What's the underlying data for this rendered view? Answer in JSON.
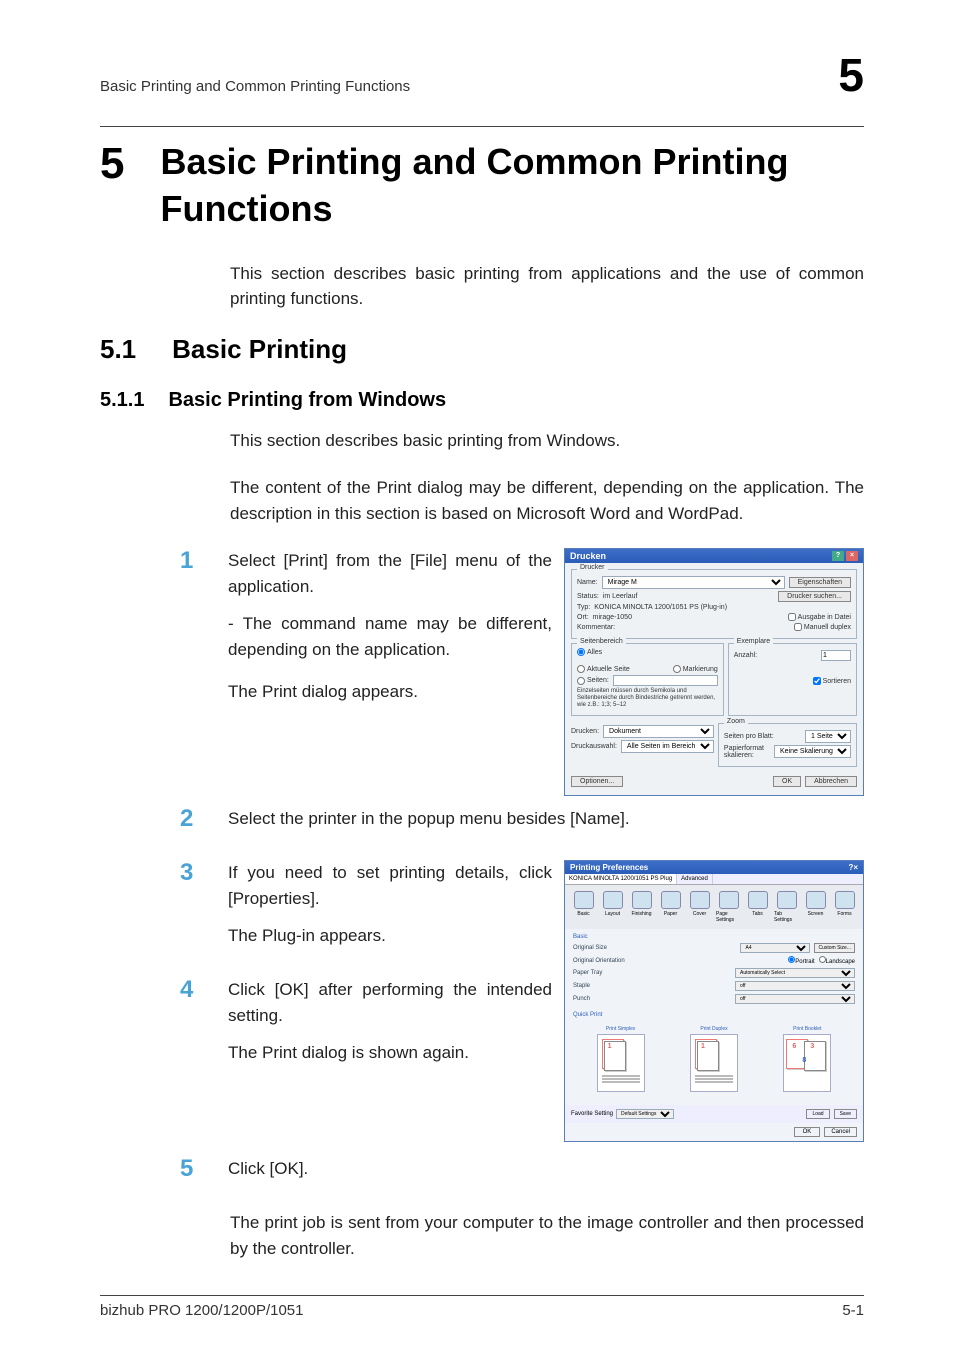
{
  "header": {
    "left": "Basic Printing and Common Printing Functions",
    "right": "5"
  },
  "chapter": {
    "num": "5",
    "title": "Basic Printing and Common Printing Functions"
  },
  "intro": "This section describes basic printing from applications and the use of common printing functions.",
  "sec1": {
    "num": "5.1",
    "title": "Basic Printing"
  },
  "sec2": {
    "num": "5.1.1",
    "title": "Basic Printing from Windows"
  },
  "sec2_p1": "This section describes basic printing from Windows.",
  "sec2_p2": "The content of the Print dialog may be different, depending on the application. The description in this section is based on Microsoft Word and WordPad.",
  "steps": {
    "s1": {
      "num": "1",
      "a": "Select [Print] from the [File] menu of the application.",
      "b": "- The command name may be different, depending on the application.",
      "c": "The Print dialog appears."
    },
    "s2": {
      "num": "2",
      "a": "Select the printer in the popup menu besides [Name]."
    },
    "s3": {
      "num": "3",
      "a": "If you need to set printing details, click [Properties].",
      "b": "The Plug-in appears."
    },
    "s4": {
      "num": "4",
      "a": "Click [OK] after performing the intended setting.",
      "b": "The Print dialog is shown again."
    },
    "s5": {
      "num": "5",
      "a": "Click [OK]."
    }
  },
  "outro": "The print job is sent from your computer to the image controller and then processed by the controller.",
  "footer": {
    "left": "bizhub PRO 1200/1200P/1051",
    "right": "5-1"
  },
  "printdlg": {
    "title": "Drucken",
    "printer_legend": "Drucker",
    "name_lbl": "Name:",
    "name_val": "Mirage M",
    "status_lbl": "Status:",
    "status_val": "im Leerlauf",
    "type_lbl": "Typ:",
    "type_val": "KONICA MINOLTA 1200/1051 PS (Plug-in)",
    "where_lbl": "Ort:",
    "where_val": "mirage-1050",
    "comment_lbl": "Kommentar:",
    "props_btn": "Eigenschaften",
    "find_btn": "Drucker suchen...",
    "tofile": "Ausgabe in Datei",
    "manual": "Manuell duplex",
    "range_legend": "Seitenbereich",
    "all": "Alles",
    "current": "Aktuelle Seite",
    "selection": "Markierung",
    "pages": "Seiten:",
    "range_hint": "Einzelseiten müssen durch Semikola und Seitenbereiche durch Bindestriche getrennt werden, wie z.B.: 1;3; 5–12",
    "copies_legend": "Exemplare",
    "copies_lbl": "Anzahl:",
    "copies_val": "1",
    "collate": "Sortieren",
    "printwhat_lbl": "Drucken:",
    "printwhat_val": "Dokument",
    "printsel_lbl": "Druckauswahl:",
    "printsel_val": "Alle Seiten im Bereich",
    "zoom_legend": "Zoom",
    "ppp_lbl": "Seiten pro Blatt:",
    "ppp_val": "1 Seite",
    "scale_lbl": "Papierformat skalieren:",
    "scale_val": "Keine Skalierung",
    "options_btn": "Optionen...",
    "ok": "OK",
    "cancel": "Abbrechen"
  },
  "plugin": {
    "title": "Printing Preferences",
    "tab1": "KONICA MINOLTA 1200/1051 PS Plug",
    "tab2": "Advanced",
    "icons": [
      "Basic",
      "Layout",
      "Finishing",
      "Paper",
      "Cover",
      "Page Settings",
      "Tabs",
      "Tab Settings",
      "Screen",
      "Forms"
    ],
    "section": "Basic",
    "size_lbl": "Original Size",
    "size_val": "A4",
    "custom_btn": "Custom Size...",
    "orient_lbl": "Original Orientation",
    "orient_p": "Portrait",
    "orient_l": "Landscape",
    "tray_lbl": "Paper Tray",
    "tray_val": "Automatically Select",
    "staple_lbl": "Staple",
    "staple_val": "off",
    "punch_lbl": "Punch",
    "punch_val": "off",
    "quick": "Quick Print",
    "pv1": "Print Simplex",
    "pv2": "Print Duplex",
    "pv3": "Print Booklet",
    "fav_lbl": "Favorite Setting",
    "fav_val": "Default Settings",
    "load": "Load",
    "save": "Save",
    "ok": "OK",
    "cancel": "Cancel"
  }
}
